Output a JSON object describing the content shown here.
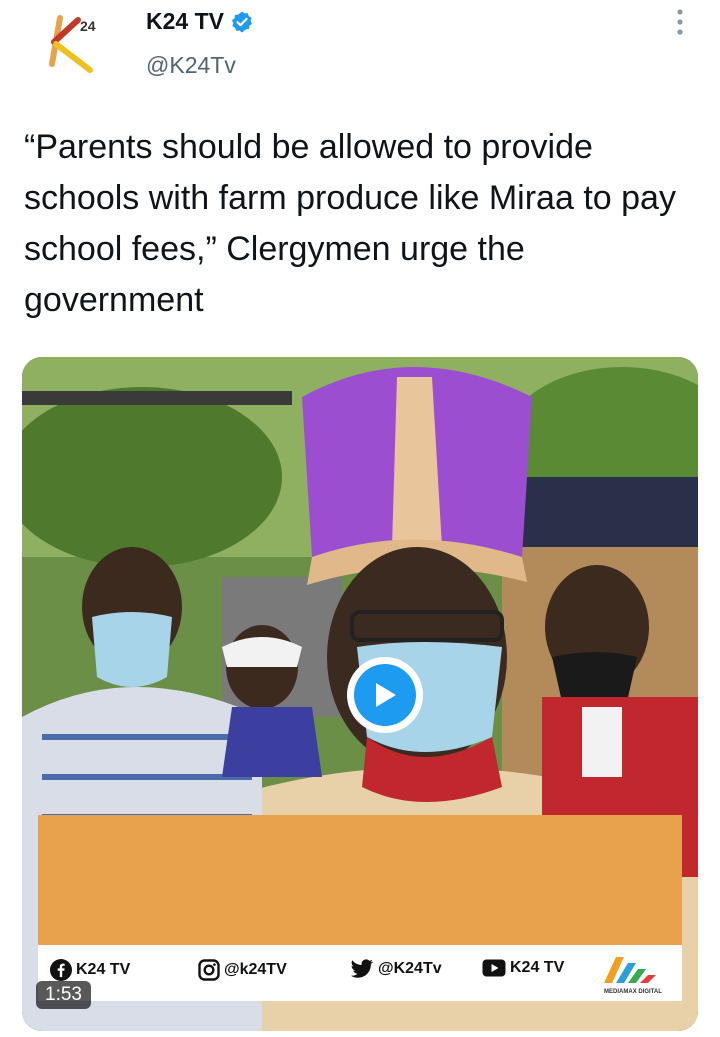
{
  "account": {
    "name": "K24 TV",
    "handle": "@K24Tv",
    "logo_text": "24",
    "verified": true
  },
  "tweet": {
    "text": "“Parents should be allowed to provide schools with farm produce like Miraa to pay school fees,” Clergymen urge the government"
  },
  "video": {
    "duration": "1:53",
    "social": {
      "facebook": "K24 TV",
      "instagram": "@k24TV",
      "twitter": "@K24Tv",
      "youtube": "K24 TV"
    },
    "broadcaster_logo": "MEDIAMAX DIGITAL"
  },
  "colors": {
    "accent": "#1d9bf0",
    "banner": "#e8a24e",
    "mitre": "#9b4fd0"
  }
}
